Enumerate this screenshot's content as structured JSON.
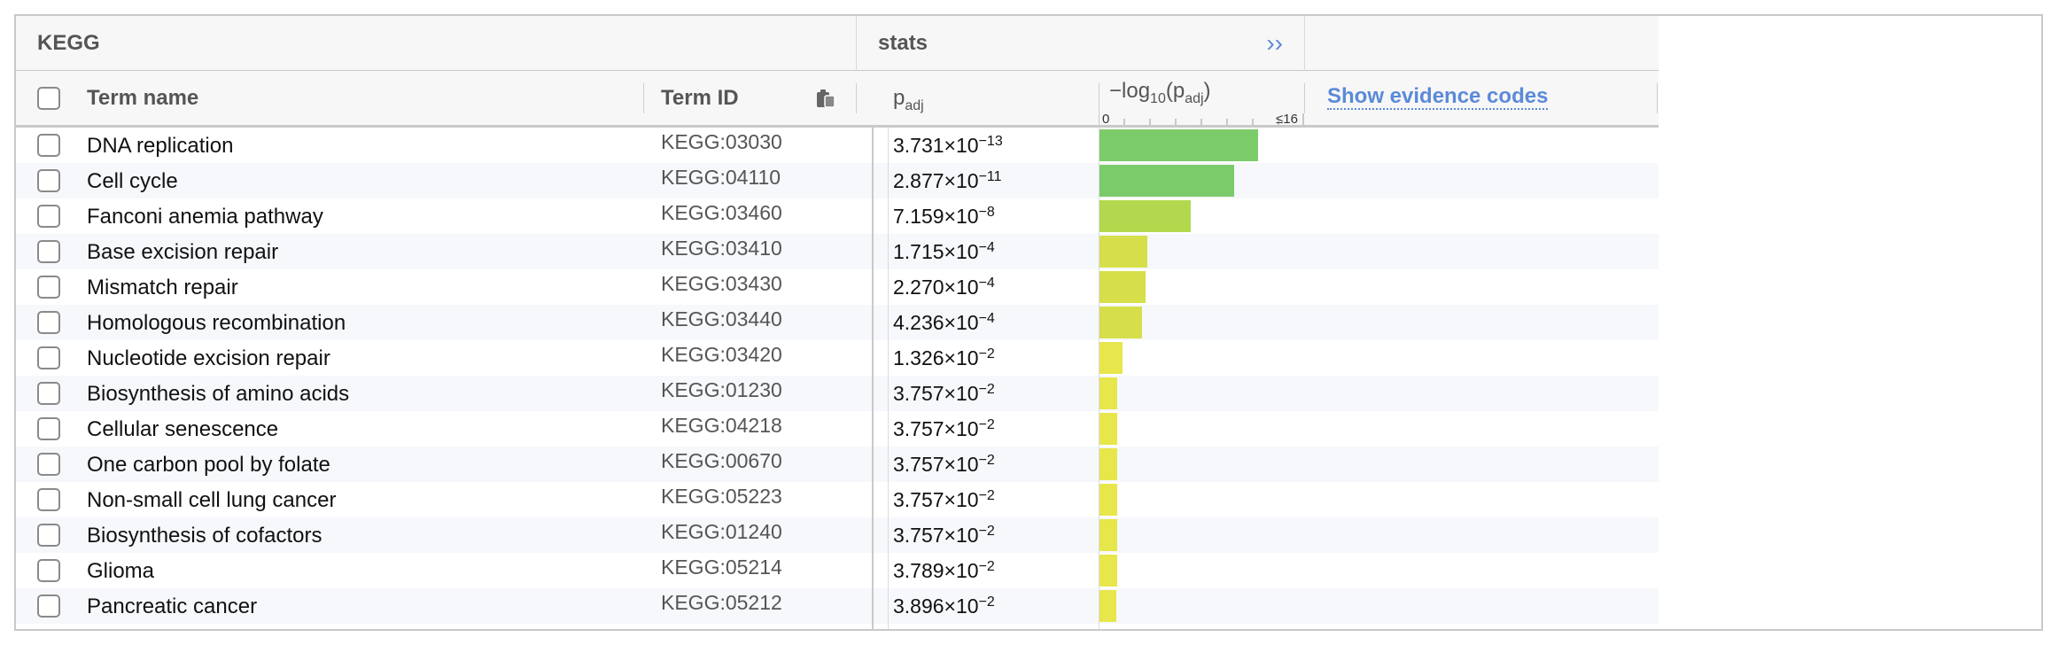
{
  "group_header": {
    "kegg_label": "KEGG",
    "stats_label": "stats",
    "expand_glyph": "››"
  },
  "columns": {
    "term_name": "Term name",
    "term_id": "Term ID",
    "padj_main": "p",
    "padj_sub": "adj",
    "log_prefix": "−log",
    "log_base": "10",
    "log_p": "(p",
    "log_sub": "adj",
    "log_close": ")",
    "axis_min": "0",
    "axis_max": "≤16",
    "evidence_link": "Show evidence codes"
  },
  "icons": {
    "copy": "clipboard-icon",
    "expand": "double-chevron-right-icon"
  },
  "colors": {
    "dark_green": "#7ccb6a",
    "light_green": "#b2d94d",
    "yellow_green": "#d6df4a",
    "yellow": "#e7e64b",
    "link": "#5b8ad8"
  },
  "axis_max_value": 16,
  "rows": [
    {
      "name": "DNA replication",
      "id": "KEGG:03030",
      "p_mant": "3.731×10",
      "p_exp": "−13",
      "neglog": 12.43
    },
    {
      "name": "Cell cycle",
      "id": "KEGG:04110",
      "p_mant": "2.877×10",
      "p_exp": "−11",
      "neglog": 10.54
    },
    {
      "name": "Fanconi anemia pathway",
      "id": "KEGG:03460",
      "p_mant": "7.159×10",
      "p_exp": "−8",
      "neglog": 7.15
    },
    {
      "name": "Base excision repair",
      "id": "KEGG:03410",
      "p_mant": "1.715×10",
      "p_exp": "−4",
      "neglog": 3.77
    },
    {
      "name": "Mismatch repair",
      "id": "KEGG:03430",
      "p_mant": "2.270×10",
      "p_exp": "−4",
      "neglog": 3.64
    },
    {
      "name": "Homologous recombination",
      "id": "KEGG:03440",
      "p_mant": "4.236×10",
      "p_exp": "−4",
      "neglog": 3.37
    },
    {
      "name": "Nucleotide excision repair",
      "id": "KEGG:03420",
      "p_mant": "1.326×10",
      "p_exp": "−2",
      "neglog": 1.88
    },
    {
      "name": "Biosynthesis of amino acids",
      "id": "KEGG:01230",
      "p_mant": "3.757×10",
      "p_exp": "−2",
      "neglog": 1.43
    },
    {
      "name": "Cellular senescence",
      "id": "KEGG:04218",
      "p_mant": "3.757×10",
      "p_exp": "−2",
      "neglog": 1.43
    },
    {
      "name": "One carbon pool by folate",
      "id": "KEGG:00670",
      "p_mant": "3.757×10",
      "p_exp": "−2",
      "neglog": 1.43
    },
    {
      "name": "Non-small cell lung cancer",
      "id": "KEGG:05223",
      "p_mant": "3.757×10",
      "p_exp": "−2",
      "neglog": 1.43
    },
    {
      "name": "Biosynthesis of cofactors",
      "id": "KEGG:01240",
      "p_mant": "3.757×10",
      "p_exp": "−2",
      "neglog": 1.43
    },
    {
      "name": "Glioma",
      "id": "KEGG:05214",
      "p_mant": "3.789×10",
      "p_exp": "−2",
      "neglog": 1.42
    },
    {
      "name": "Pancreatic cancer",
      "id": "KEGG:05212",
      "p_mant": "3.896×10",
      "p_exp": "−2",
      "neglog": 1.41
    }
  ]
}
